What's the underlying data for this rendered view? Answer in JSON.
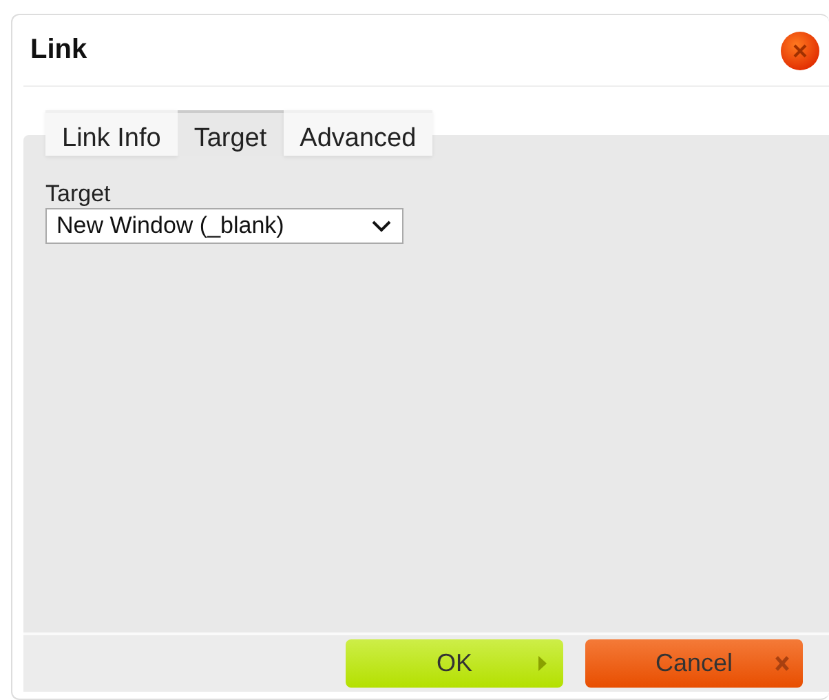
{
  "window": {
    "title": "Link"
  },
  "tabs": [
    {
      "label": "Link Info",
      "selected": false
    },
    {
      "label": "Target",
      "selected": true
    },
    {
      "label": "Advanced",
      "selected": false
    }
  ],
  "target": {
    "label": "Target",
    "value": "New Window (_blank)"
  },
  "buttons": [
    {
      "label": "OK",
      "kind": "ok"
    },
    {
      "label": "Cancel",
      "kind": "cancel"
    }
  ]
}
